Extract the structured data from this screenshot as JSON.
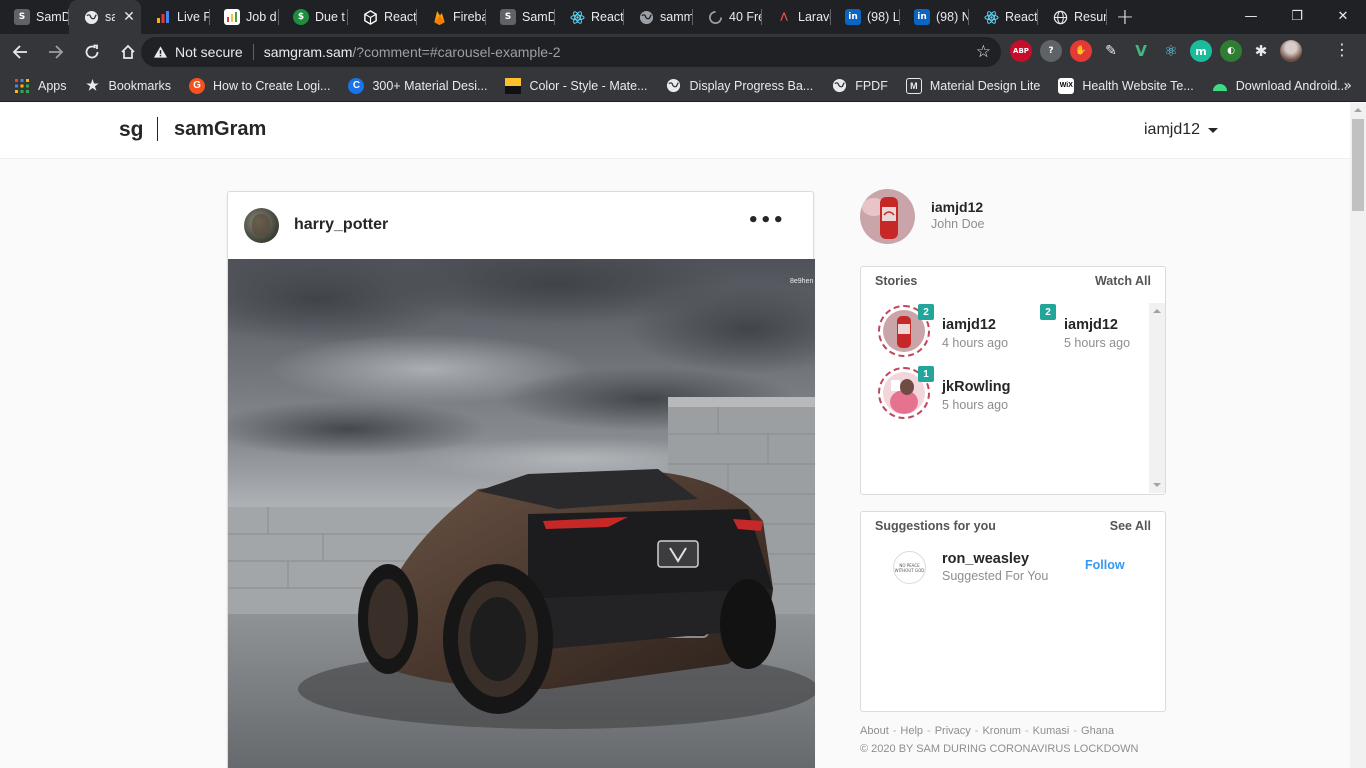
{
  "browser": {
    "tabs": [
      {
        "title": "SamD",
        "icon": "samd-icon",
        "color": "#5f6368"
      },
      {
        "title": "sa",
        "icon": "globe-icon",
        "color": "#e8eaed",
        "active": true
      },
      {
        "title": "Live F",
        "icon": "chart-icon",
        "color": "#f4b400"
      },
      {
        "title": "Job d",
        "icon": "doc-icon",
        "color": "#e53935"
      },
      {
        "title": "Due t",
        "icon": "dollar-icon",
        "color": "#1e8e3e"
      },
      {
        "title": "React",
        "icon": "codesandbox-icon",
        "color": "#ffffff"
      },
      {
        "title": "Fireba",
        "icon": "firebase-icon",
        "color": "#ffa000"
      },
      {
        "title": "SamD",
        "icon": "samd-icon",
        "color": "#5f6368"
      },
      {
        "title": "React",
        "icon": "react-icon",
        "color": "#61dafb"
      },
      {
        "title": "samm",
        "icon": "globe-icon",
        "color": "#9aa0a6"
      },
      {
        "title": "40 Fre",
        "icon": "spinner-icon",
        "color": "#9aa0a6"
      },
      {
        "title": "Larave",
        "icon": "laravel-icon",
        "color": "#f05340"
      },
      {
        "title": "(98) L",
        "icon": "linkedin-icon",
        "color": "#0a66c2"
      },
      {
        "title": "(98) N",
        "icon": "linkedin-icon",
        "color": "#0a66c2"
      },
      {
        "title": "React",
        "icon": "react-icon",
        "color": "#61dafb"
      },
      {
        "title": "Resun",
        "icon": "globe-icon",
        "color": "#e8eaed"
      }
    ],
    "address": {
      "security": "Not secure",
      "host": "samgram.sam",
      "path": "/?comment=#carousel-example-2"
    },
    "extensions": [
      {
        "name": "adblock-plus-icon",
        "label": "ABP",
        "color": "#c70d2c"
      },
      {
        "name": "help-badge-icon",
        "label": "?",
        "color": "#5f6368"
      },
      {
        "name": "ublock-icon",
        "label": "✋",
        "color": "#e53935"
      },
      {
        "name": "eyedropper-icon",
        "label": "✎",
        "color": "#35363a"
      },
      {
        "name": "vue-devtools-icon",
        "label": "V",
        "color": "#35363a"
      },
      {
        "name": "react-devtools-icon",
        "label": "⚛",
        "color": "#35363a"
      },
      {
        "name": "m-extension-icon",
        "label": "m",
        "color": "#1abc9c"
      },
      {
        "name": "globe-extension-icon",
        "label": "◐",
        "color": "#2e7d32"
      },
      {
        "name": "puzzle-icon",
        "label": "✱",
        "color": "#35363a"
      },
      {
        "name": "profile-avatar-icon",
        "label": "",
        "color": "#8d6e63"
      }
    ],
    "bookmarks": [
      {
        "label": "Apps",
        "icon": "apps-grid-icon",
        "color": "#4285f4"
      },
      {
        "label": "Bookmarks",
        "icon": "star-icon",
        "color": "#e8eaed"
      },
      {
        "label": "How to Create Logi...",
        "icon": "orange-g-icon",
        "color": "#f4511e"
      },
      {
        "label": "300+ Material Desi...",
        "icon": "c-icon",
        "color": "#1a73e8"
      },
      {
        "label": "Color - Style - Mate...",
        "icon": "material-color-icon",
        "color": "#fbc02d"
      },
      {
        "label": "Display Progress Ba...",
        "icon": "globe-icon",
        "color": "#e8eaed"
      },
      {
        "label": "FPDF",
        "icon": "globe-icon",
        "color": "#e8eaed"
      },
      {
        "label": "Material Design Lite",
        "icon": "mdl-icon",
        "color": "#e8eaed"
      },
      {
        "label": "Health Website Te...",
        "icon": "wix-icon",
        "color": "#ffffff"
      },
      {
        "label": "Download Android...",
        "icon": "android-icon",
        "color": "#3ddc84"
      }
    ]
  },
  "site": {
    "logo_short": "sg",
    "logo_name": "samGram",
    "current_user": "iamjd12"
  },
  "post": {
    "username": "harry_potter",
    "more": "•••"
  },
  "profile": {
    "handle": "iamjd12",
    "full_name": "John Doe"
  },
  "stories": {
    "title": "Stories",
    "action": "Watch All",
    "items": [
      {
        "user": "iamjd12",
        "time": "4 hours ago",
        "count": "2"
      },
      {
        "user": "iamjd12",
        "time": "5 hours ago",
        "count": "2"
      },
      {
        "user": "jkRowling",
        "time": "5 hours ago",
        "count": "1"
      }
    ]
  },
  "suggestions": {
    "title": "Suggestions for you",
    "action": "See All",
    "items": [
      {
        "user": "ron_weasley",
        "subtitle": "Suggested For You",
        "follow": "Follow",
        "avatar_text": "NO PEACE WITHOUT GOD"
      }
    ]
  },
  "footer": {
    "links": [
      "About",
      "Help",
      "Privacy",
      "Kronum",
      "Kumasi",
      "Ghana"
    ],
    "separator": "-",
    "copyright": "© 2020 BY SAM DURING CORONAVIRUS LOCKDOWN"
  },
  "colors": {
    "story_ring": "#c2475c",
    "story_badge": "#22a699",
    "follow_link": "#3897f0"
  }
}
